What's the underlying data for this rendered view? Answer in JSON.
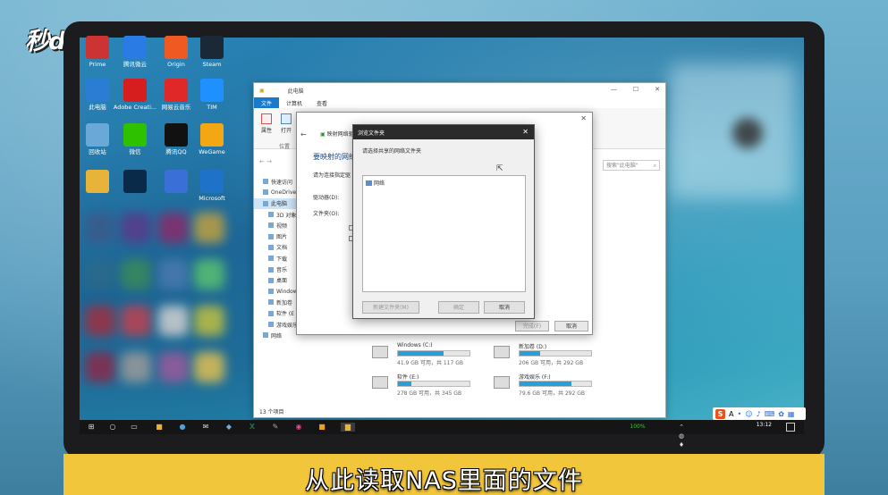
{
  "brand": "秒dong视频",
  "caption": "从此读取NAS里面的文件",
  "desktop_icons": [
    {
      "label": "Prime",
      "icon": "prime-icon",
      "color": "#c33"
    },
    {
      "label": "腾讯微云",
      "icon": "weiyun-icon",
      "color": "#2a7be4"
    },
    {
      "label": "Origin",
      "icon": "origin-icon",
      "color": "#f05a22"
    },
    {
      "label": "Steam",
      "icon": "steam-icon",
      "color": "#1b2838"
    },
    {
      "label": "此电脑",
      "icon": "this-pc-icon",
      "color": "#2b7cd3"
    },
    {
      "label": "Adobe Creati...",
      "icon": "adobe-cc-icon",
      "color": "#d71e1e"
    },
    {
      "label": "网易云音乐",
      "icon": "netease-music-icon",
      "color": "#e12828"
    },
    {
      "label": "TIM",
      "icon": "tim-icon",
      "color": "#1e90ff"
    },
    {
      "label": "回收站",
      "icon": "recycle-bin-icon",
      "color": "#6aa8d8"
    },
    {
      "label": "微信",
      "icon": "wechat-icon",
      "color": "#2dc100"
    },
    {
      "label": "腾讯QQ",
      "icon": "qq-icon",
      "color": "#111"
    },
    {
      "label": "WeGame",
      "icon": "wegame-icon",
      "color": "#f3a712"
    },
    {
      "label": "",
      "icon": "folder-icon",
      "color": "#e8b339"
    },
    {
      "label": "",
      "icon": "photoshop-icon",
      "color": "#0a2a4a"
    },
    {
      "label": "",
      "icon": "baidu-icon",
      "color": "#3a6fd8"
    },
    {
      "label": "Microsoft",
      "icon": "edge-icon",
      "color": "#1e73c8"
    }
  ],
  "explorer": {
    "title": "此电脑",
    "tabs": [
      "文件",
      "计算机",
      "查看"
    ],
    "ribbon": [
      {
        "label": "属性"
      },
      {
        "label": "打开"
      }
    ],
    "location_group": "位置",
    "search_placeholder": "搜索\"此电脑\"",
    "nav": [
      {
        "label": "快速访问"
      },
      {
        "label": "OneDrive"
      },
      {
        "label": "此电脑",
        "selected": true
      },
      {
        "label": "3D 对象"
      },
      {
        "label": "视频"
      },
      {
        "label": "图片"
      },
      {
        "label": "文档"
      },
      {
        "label": "下载"
      },
      {
        "label": "音乐"
      },
      {
        "label": "桌面"
      },
      {
        "label": "Windows"
      },
      {
        "label": "新加卷"
      },
      {
        "label": "软件 (E"
      },
      {
        "label": "游戏娱乐 (F:)"
      },
      {
        "label": "网络"
      }
    ],
    "drives": [
      {
        "name": "Windows (C:)",
        "free": "41.9 GB 可用，共 117 GB",
        "fill": 0.64
      },
      {
        "name": "新加卷 (D:)",
        "free": "206 GB 可用，共 292 GB",
        "fill": 0.29
      },
      {
        "name": "软件 (E:)",
        "free": "278 GB 可用，共 345 GB",
        "fill": 0.19
      },
      {
        "name": "游戏娱乐 (F:)",
        "free": "79.6 GB 可用，共 292 GB",
        "fill": 0.73
      }
    ],
    "status": "13 个项目"
  },
  "map_dialog": {
    "title": "映射网络驱动器",
    "heading": "要映射的网络",
    "desc": "请为连接指定驱",
    "drive_label": "驱动器(D):",
    "folder_label": "文件夹(O):",
    "finish": "完成(F)",
    "cancel": "取消"
  },
  "browse_dialog": {
    "title": "浏览文件夹",
    "prompt": "请选择共享的网络文件夹",
    "tree_root": "网络",
    "new_folder": "新建文件夹(M)",
    "ok": "确定",
    "cancel": "取消"
  },
  "taskbar": {
    "time": "13:12",
    "battery": "100%",
    "ime_lang": "A"
  }
}
